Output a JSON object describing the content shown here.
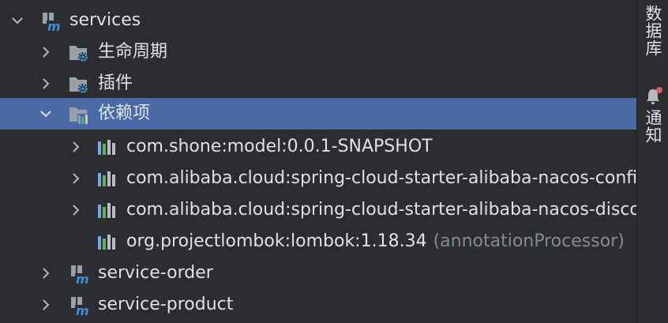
{
  "tree": {
    "root": {
      "label": "services",
      "expanded": true,
      "icon": "maven-module-icon"
    },
    "groups": [
      {
        "label": "生命周期",
        "expanded": false,
        "icon": "config-folder-icon"
      },
      {
        "label": "插件",
        "expanded": false,
        "icon": "config-folder-icon"
      },
      {
        "label": "依赖项",
        "expanded": true,
        "selected": true,
        "icon": "dependencies-folder-icon"
      }
    ],
    "dependencies": [
      {
        "label": "com.shone:model:0.0.1-SNAPSHOT",
        "suffix": "",
        "expandable": true
      },
      {
        "label": "com.alibaba.cloud:spring-cloud-starter-alibaba-nacos-config",
        "suffix": "",
        "expandable": true
      },
      {
        "label": "com.alibaba.cloud:spring-cloud-starter-alibaba-nacos-discovery",
        "suffix": "",
        "expandable": true
      },
      {
        "label": "org.projectlombok:lombok:1.18.34",
        "suffix": "(annotationProcessor)",
        "expandable": false
      }
    ],
    "modules": [
      {
        "label": "service-order",
        "expanded": false
      },
      {
        "label": "service-product",
        "expanded": false
      }
    ]
  },
  "sidebar": {
    "database_label": "数据库",
    "notifications_label": "通知"
  },
  "colors": {
    "background": "#2b2d30",
    "selection": "#4a6aa5",
    "text": "#dfe1e5",
    "muted": "#868a91",
    "maven_blue": "#3d8fd6",
    "dependency_bars": [
      "#7aa8d6",
      "#5fb35f",
      "#b8bcc4"
    ],
    "notification_dot": "#e55b5b"
  }
}
